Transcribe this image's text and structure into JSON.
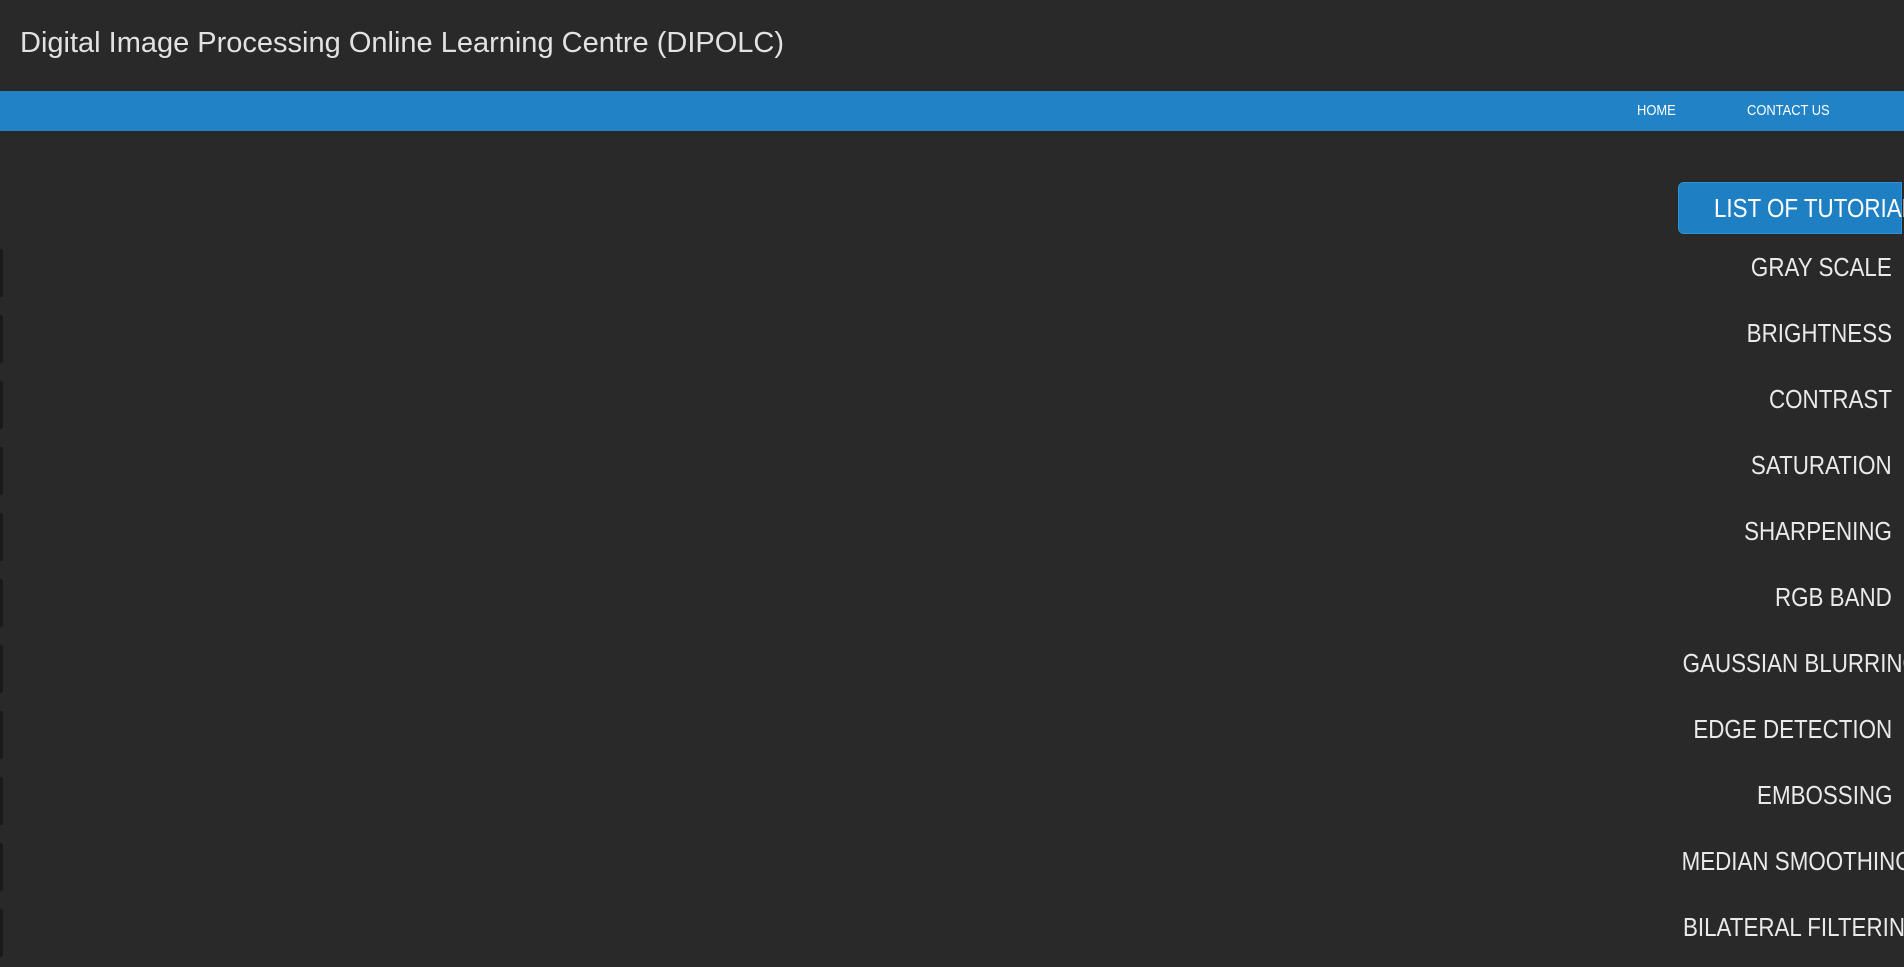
{
  "header": {
    "title": "Digital Image Processing Online Learning Centre (DIPOLC)"
  },
  "nav": {
    "home": "HOME",
    "contact": "CONTACT US"
  },
  "tutorials": {
    "heading": "LIST OF TUTORIALS",
    "items": [
      "GRAY SCALE",
      "BRIGHTNESS",
      "CONTRAST",
      "SATURATION",
      "SHARPENING",
      "RGB BAND",
      "GAUSSIAN BLURRING",
      "EDGE DETECTION",
      "EMBOSSING",
      "MEDIAN SMOOTHING",
      "BILATERAL FILTERING"
    ]
  },
  "colors": {
    "background": "#292929",
    "navbar": "#2183c6",
    "accent": "#1f7fc3",
    "text": "#e9e9e9"
  }
}
